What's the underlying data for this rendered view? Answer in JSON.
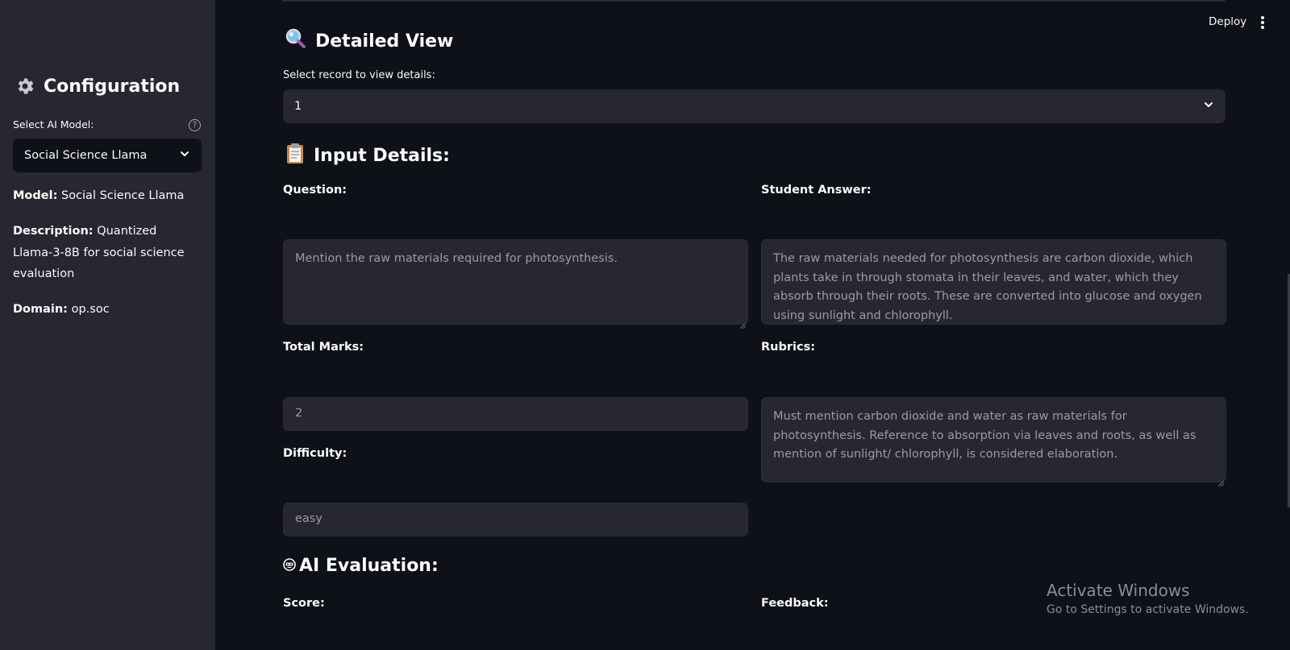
{
  "sidebar": {
    "title": "Configuration",
    "select_label": "Select AI Model:",
    "selected_model": "Social Science Llama",
    "model_label": "Model:",
    "model_value": "Social Science Llama",
    "description_label": "Description:",
    "description_value": "Quantized Llama-3-8B for social science evaluation",
    "domain_label": "Domain:",
    "domain_value": "op.soc"
  },
  "topbar": {
    "deploy_label": "Deploy"
  },
  "detailed_view": {
    "title": "Detailed View",
    "select_label": "Select record to view details:",
    "selected_record": "1"
  },
  "input_details": {
    "title": "Input Details:",
    "question_label": "Question:",
    "question_value": "Mention the raw materials required for photosynthesis.",
    "student_answer_label": "Student Answer:",
    "student_answer_value": "The raw materials needed for photosynthesis are carbon dioxide, which plants take in through stomata in their leaves, and water, which they absorb through their roots. These are converted into glucose and oxygen using sunlight and chlorophyll.",
    "total_marks_label": "Total Marks:",
    "total_marks_value": "2",
    "rubrics_label": "Rubrics:",
    "rubrics_value": "Must mention carbon dioxide and water as raw materials for photosynthesis. Reference to absorption via leaves and roots, as well as mention of sunlight/ chlorophyll, is considered elaboration.",
    "difficulty_label": "Difficulty:",
    "difficulty_value": "easy"
  },
  "ai_evaluation": {
    "title": "AI Evaluation:",
    "score_label": "Score:",
    "feedback_label": "Feedback:"
  },
  "watermark": {
    "line1": "Activate Windows",
    "line2": "Go to Settings to activate Windows."
  }
}
